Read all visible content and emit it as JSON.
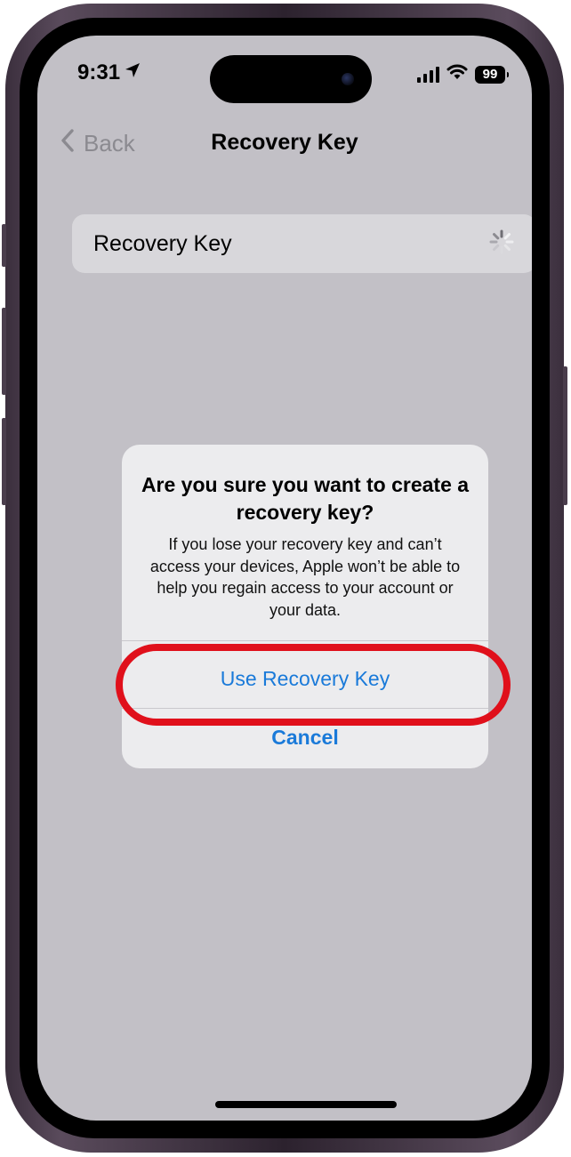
{
  "status_bar": {
    "time": "9:31",
    "battery": "99",
    "icons": [
      "location-arrow-icon",
      "cellular-signal-icon",
      "wifi-icon",
      "battery-icon"
    ]
  },
  "nav": {
    "back_label": "Back",
    "title": "Recovery Key"
  },
  "settings_row": {
    "label": "Recovery Key",
    "state_icon": "loading-spinner-icon"
  },
  "alert": {
    "title": "Are you sure you want to create a recovery key?",
    "message": "If you lose your recovery key and can’t access your devices, Apple won’t be able to help you regain access to your account or your data.",
    "primary_button": "Use Recovery Key",
    "cancel_button": "Cancel"
  },
  "colors": {
    "link_blue": "#1a7ad9",
    "highlight_red": "#e0101b",
    "screen_dim": "#c2c0c6"
  }
}
